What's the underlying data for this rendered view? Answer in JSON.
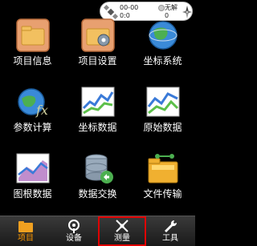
{
  "status": {
    "line1": "00-00",
    "line2": "0:0",
    "line3": "无解",
    "line4": "0"
  },
  "grid": [
    {
      "label": "项目信息",
      "icon": "project-info-icon"
    },
    {
      "label": "项目设置",
      "icon": "project-settings-icon"
    },
    {
      "label": "坐标系统",
      "icon": "coordinate-system-icon"
    },
    {
      "label": "参数计算",
      "icon": "parameter-calc-icon"
    },
    {
      "label": "坐标数据",
      "icon": "coordinate-data-icon"
    },
    {
      "label": "原始数据",
      "icon": "raw-data-icon"
    },
    {
      "label": "图根数据",
      "icon": "control-data-icon"
    },
    {
      "label": "数据交换",
      "icon": "data-exchange-icon"
    },
    {
      "label": "文件传输",
      "icon": "file-transfer-icon"
    }
  ],
  "tabs": [
    {
      "label": "项目",
      "icon": "folder-icon",
      "active": true
    },
    {
      "label": "设备",
      "icon": "device-icon",
      "active": false
    },
    {
      "label": "测量",
      "icon": "measure-icon",
      "active": false,
      "highlighted": true
    },
    {
      "label": "工具",
      "icon": "wrench-icon",
      "active": false
    }
  ],
  "colors": {
    "active_tab": "#ff9900",
    "highlight_box": "#e00000",
    "background": "#000000"
  }
}
